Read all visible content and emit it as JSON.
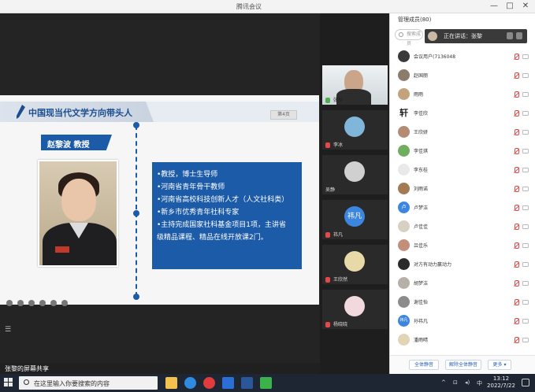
{
  "window": {
    "title": "腾讯会议",
    "min": "—",
    "max": "□",
    "close": "✕"
  },
  "slide": {
    "title": "中国现当代文学方向带头人",
    "page": "第4页",
    "name_banner": "赵黎波   教授",
    "bio": [
      "•教授，博士生导师",
      "•河南省青年骨干教师",
      "•河南省高校科技创新人才（人文社科类）",
      "•新乡市优秀青年社科专家",
      "•主持完成国家社科基金项目1项，主讲省",
      "级精品课程、精品在线开放课2门。"
    ]
  },
  "share": {
    "label": "张黎的屏幕共享"
  },
  "videos": [
    {
      "name": "张黎",
      "muted": false
    },
    {
      "name": "李冰",
      "muted": true
    },
    {
      "name": "吴静",
      "muted": false
    },
    {
      "name": "祎凡",
      "muted": true,
      "avatar_text": "祎凡"
    },
    {
      "name": "王欣然",
      "muted": true
    },
    {
      "name": "杨晓晓",
      "muted": true
    }
  ],
  "panel": {
    "title": "管理成员(80)",
    "search_placeholder": "搜索成员",
    "speaking": "正在讲话：张黎",
    "participants": [
      {
        "name": "会议用户(7136048",
        "avatar_text": ""
      },
      {
        "name": "赵国丽",
        "avatar_text": ""
      },
      {
        "name": "雨雨",
        "avatar_text": ""
      },
      {
        "name": "李佳欣",
        "avatar_text": "轩"
      },
      {
        "name": "王欣妍",
        "avatar_text": ""
      },
      {
        "name": "李佳琪",
        "avatar_text": ""
      },
      {
        "name": "李东桂",
        "avatar_text": ""
      },
      {
        "name": "刘雨诺",
        "avatar_text": ""
      },
      {
        "name": "卢梦洁",
        "avatar_text": "卢"
      },
      {
        "name": "卢佳佳",
        "avatar_text": ""
      },
      {
        "name": "吕佳乐",
        "avatar_text": ""
      },
      {
        "name": "对方有动力赢动力",
        "avatar_text": ""
      },
      {
        "name": "胡梦洁",
        "avatar_text": ""
      },
      {
        "name": "谢佳怡",
        "avatar_text": ""
      },
      {
        "name": "孙祎凡",
        "avatar_text": "祎凡"
      },
      {
        "name": "潘雨晴",
        "avatar_text": ""
      }
    ],
    "mute_all": "全体静音",
    "unmute_all": "解除全体静音",
    "more": "更多 ▾"
  },
  "taskbar": {
    "search_placeholder": "在这里输入你要搜索的内容",
    "time": "13:12",
    "date": "2022/7/22",
    "ime": "中",
    "tray_up": "^"
  },
  "colors": {
    "accent": "#1c5ba8",
    "title_blue": "#1c4e8f",
    "muted_red": "#e14a4a"
  }
}
